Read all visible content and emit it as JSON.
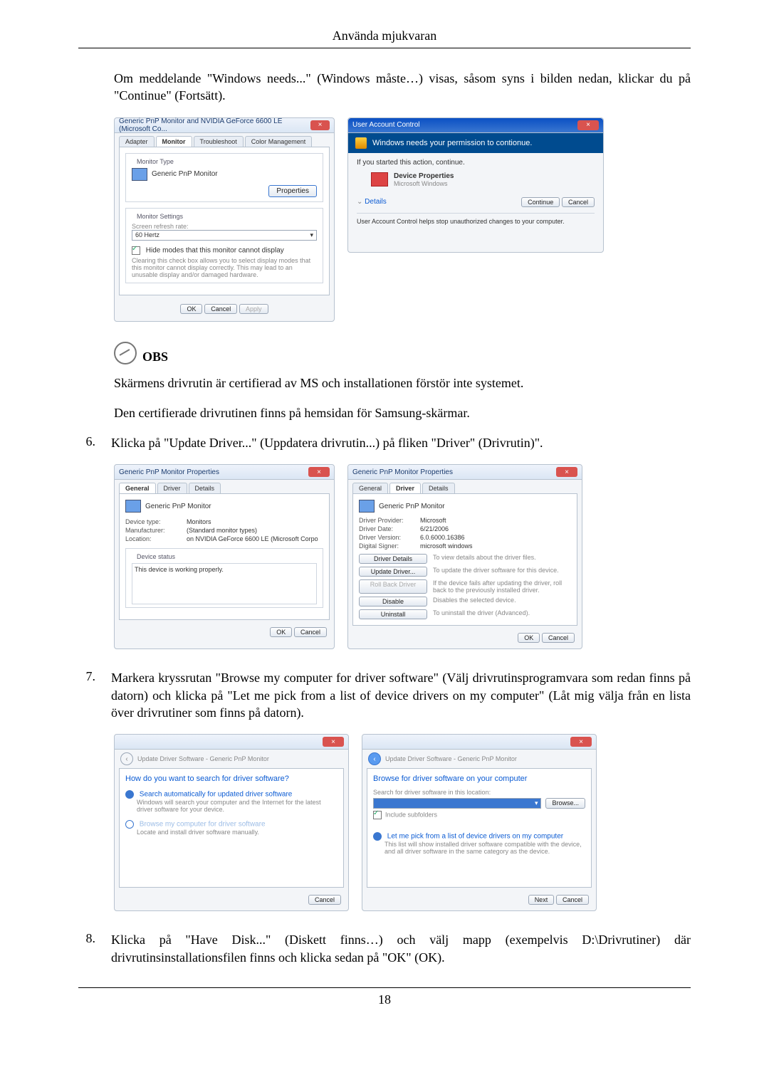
{
  "header": {
    "title": "Använda mjukvaran"
  },
  "intro": "Om meddelande \"Windows needs...\" (Windows måste…) visas, såsom syns i bilden nedan, klickar du på \"Continue\" (Fortsätt).",
  "fig1_left": {
    "title": "Generic PnP Monitor and NVIDIA GeForce 6600 LE (Microsoft Co...",
    "tabs": [
      "Adapter",
      "Monitor",
      "Troubleshoot",
      "Color Management"
    ],
    "monitor_type_legend": "Monitor Type",
    "monitor_type": "Generic PnP Monitor",
    "properties_btn": "Properties",
    "settings_legend": "Monitor Settings",
    "refresh_label": "Screen refresh rate:",
    "refresh_value": "60 Hertz",
    "hide_modes": "Hide modes that this monitor cannot display",
    "hide_modes_note": "Clearing this check box allows you to select display modes that this monitor cannot display correctly. This may lead to an unusable display and/or damaged hardware.",
    "ok": "OK",
    "cancel": "Cancel",
    "apply": "Apply"
  },
  "fig1_right": {
    "title": "User Account Control",
    "banner": "Windows needs your permission to contionue.",
    "started": "If you started this action, continue.",
    "prog1": "Device Properties",
    "prog2": "Microsoft Windows",
    "details": "Details",
    "continue": "Continue",
    "cancel": "Cancel",
    "footer": "User Account Control helps stop unauthorized changes to your computer."
  },
  "obs": {
    "label": "OBS",
    "line1": "Skärmens drivrutin är certifierad av MS och installationen förstör inte systemet.",
    "line2": "Den certifierade drivrutinen finns på hemsidan för Samsung-skärmar."
  },
  "step6": {
    "num": "6.",
    "text": "Klicka på \"Update Driver...\" (Uppdatera drivrutin...) på fliken \"Driver\" (Drivrutin)\"."
  },
  "fig2_left": {
    "title": "Generic PnP Monitor Properties",
    "tabs": [
      "General",
      "Driver",
      "Details"
    ],
    "name": "Generic PnP Monitor",
    "kv": {
      "devtype_k": "Device type:",
      "devtype_v": "Monitors",
      "manu_k": "Manufacturer:",
      "manu_v": "(Standard monitor types)",
      "loc_k": "Location:",
      "loc_v": "on NVIDIA GeForce 6600 LE (Microsoft Corpo"
    },
    "status_legend": "Device status",
    "status_text": "This device is working properly.",
    "ok": "OK",
    "cancel": "Cancel"
  },
  "fig2_right": {
    "title": "Generic PnP Monitor Properties",
    "tabs": [
      "General",
      "Driver",
      "Details"
    ],
    "name": "Generic PnP Monitor",
    "kv": {
      "prov_k": "Driver Provider:",
      "prov_v": "Microsoft",
      "date_k": "Driver Date:",
      "date_v": "6/21/2006",
      "ver_k": "Driver Version:",
      "ver_v": "6.0.6000.16386",
      "sig_k": "Digital Signer:",
      "sig_v": "microsoft windows"
    },
    "btns": {
      "details": "Driver Details",
      "details_d": "To view details about the driver files.",
      "update": "Update Driver...",
      "update_d": "To update the driver software for this device.",
      "roll": "Roll Back Driver",
      "roll_d": "If the device fails after updating the driver, roll back to the previously installed driver.",
      "disable": "Disable",
      "disable_d": "Disables the selected device.",
      "uninstall": "Uninstall",
      "uninstall_d": "To uninstall the driver (Advanced)."
    },
    "ok": "OK",
    "cancel": "Cancel"
  },
  "step7": {
    "num": "7.",
    "text": "Markera kryssrutan \"Browse my computer for driver software\" (Välj drivrutinsprogramvara som redan finns på datorn) och klicka på \"Let me pick from a list of device drivers on my computer\" (Låt mig välja från en lista över drivrutiner som finns på datorn)."
  },
  "fig3_left": {
    "breadcrumb": "Update Driver Software - Generic PnP Monitor",
    "heading": "How do you want to search for driver software?",
    "opt1_title": "Search automatically for updated driver software",
    "opt1_desc": "Windows will search your computer and the Internet for the latest driver software for your device.",
    "opt2_title": "Browse my computer for driver software",
    "opt2_desc": "Locate and install driver software manually.",
    "cancel": "Cancel"
  },
  "fig3_right": {
    "breadcrumb": "Update Driver Software - Generic PnP Monitor",
    "heading": "Browse for driver software on your computer",
    "search_label": "Search for driver software in this location:",
    "browse": "Browse...",
    "include": "Include subfolders",
    "pick_title": "Let me pick from a list of device drivers on my computer",
    "pick_desc": "This list will show installed driver software compatible with the device, and all driver software in the same category as the device.",
    "next": "Next",
    "cancel": "Cancel"
  },
  "step8": {
    "num": "8.",
    "text": "Klicka på \"Have Disk...\" (Diskett finns…) och välj mapp (exempelvis D:\\Drivrutiner) där drivrutinsinstallationsfilen finns och klicka sedan på \"OK\" (OK)."
  },
  "page_number": "18"
}
